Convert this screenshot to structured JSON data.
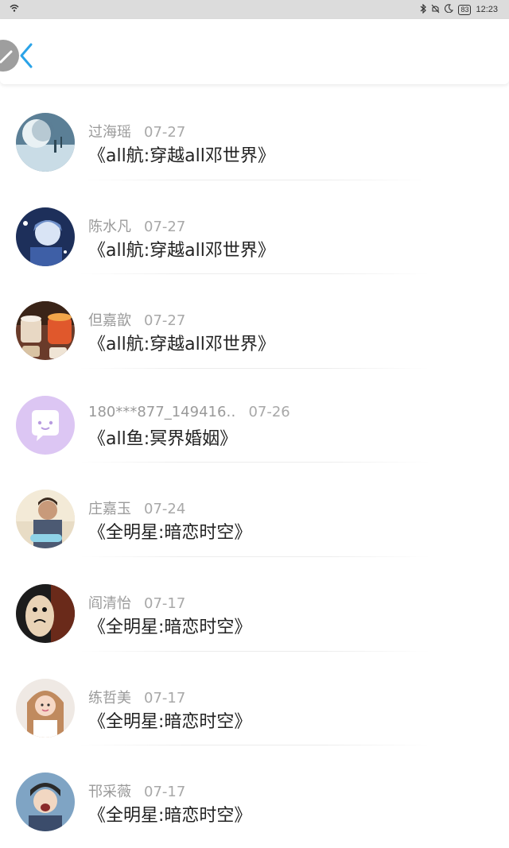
{
  "status_bar": {
    "time": "12:23",
    "battery": "83",
    "icons": [
      "wifi-icon",
      "bluetooth-icon",
      "mute-icon",
      "moon-icon"
    ]
  },
  "header": {
    "icons": [
      "edit-icon",
      "back-arrow-icon"
    ],
    "accent": "#2aa3e8"
  },
  "comments": [
    {
      "name": "过海瑶",
      "date": "07-27",
      "title": "《all航:穿越all邓世界》",
      "avatar": "avatar-moon"
    },
    {
      "name": "陈水凡",
      "date": "07-27",
      "title": "《all航:穿越all邓世界》",
      "avatar": "avatar-anime"
    },
    {
      "name": "但嘉歆",
      "date": "07-27",
      "title": "《all航:穿越all邓世界》",
      "avatar": "avatar-candles"
    },
    {
      "name": "180***877_149416‥",
      "date": "07-26",
      "title": "《all鱼:冥界婚姻》",
      "avatar": "avatar-default-chat"
    },
    {
      "name": "庄嘉玉",
      "date": "07-24",
      "title": "《全明星:暗恋时空》",
      "avatar": "avatar-man"
    },
    {
      "name": "阎清怡",
      "date": "07-17",
      "title": "《全明星:暗恋时空》",
      "avatar": "avatar-egg-face"
    },
    {
      "name": "练哲美",
      "date": "07-17",
      "title": "《全明星:暗恋时空》",
      "avatar": "avatar-girl"
    },
    {
      "name": "邗采薇",
      "date": "07-17",
      "title": "《全明星:暗恋时空》",
      "avatar": "avatar-boy"
    }
  ]
}
